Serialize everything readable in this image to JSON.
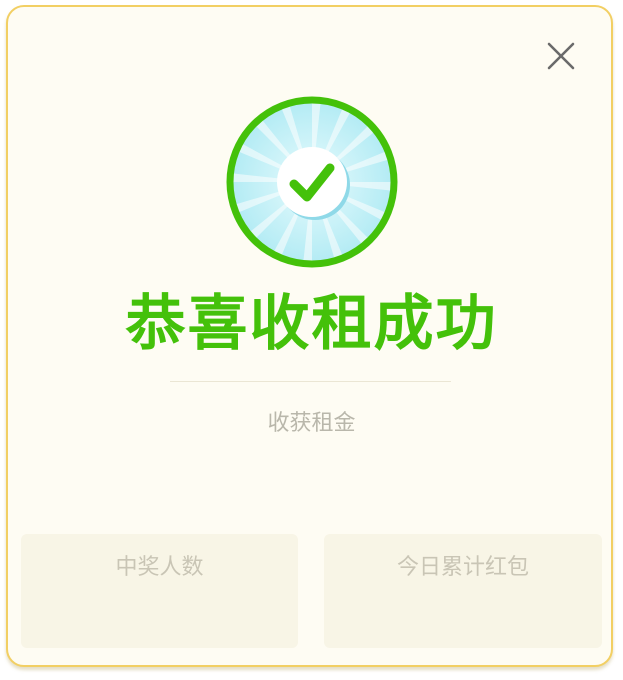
{
  "dialog": {
    "title": "恭喜收租成功",
    "subtitle": "收获租金",
    "stats": {
      "winners_label": "中奖人数",
      "today_total_label": "今日累计红包"
    }
  },
  "icons": {
    "close": "close-icon",
    "success": "checkmark-badge-icon"
  },
  "colors": {
    "accent_green": "#44c10a",
    "border_gold": "#f2cf63",
    "badge_blue": "#bfeff7"
  }
}
